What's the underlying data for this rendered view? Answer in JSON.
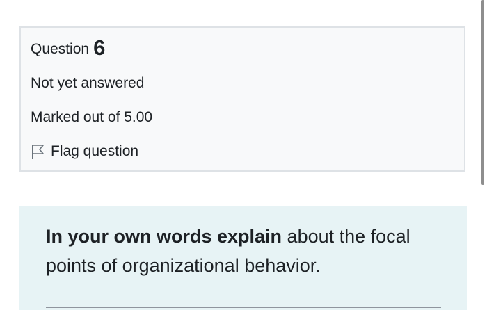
{
  "question": {
    "label": "Question",
    "number": "6",
    "state": "Not yet answered",
    "grade": "Marked out of 5.00",
    "flag_label": "Flag question",
    "flag_icon": "flag-outline-icon"
  },
  "question_text": {
    "bold": "In your own words explain",
    "rest": " about the focal points of organizational behavior."
  },
  "colors": {
    "info_background": "#f8f9fa",
    "info_border": "#dee2e6",
    "question_text_background": "#e7f3f5"
  }
}
